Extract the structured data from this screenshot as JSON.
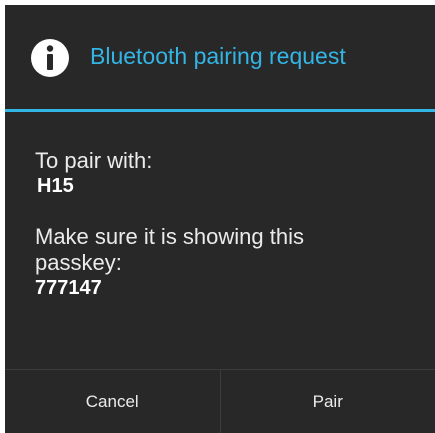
{
  "dialog": {
    "title": "Bluetooth pairing request",
    "icon": "info-icon",
    "accent_color": "#33b5e5",
    "background_color": "#282828"
  },
  "body": {
    "pair_with_label": "To pair with:",
    "device_name": "H15",
    "instruction_line1": "Make sure it is showing this",
    "instruction_line2": "passkey:",
    "passkey": "777147"
  },
  "buttons": {
    "cancel_label": "Cancel",
    "pair_label": "Pair"
  }
}
